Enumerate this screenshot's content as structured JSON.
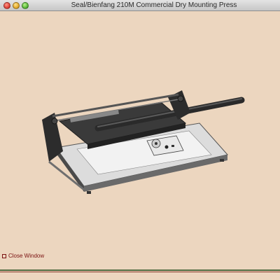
{
  "window": {
    "title": "Seal/Bienfang 210M Commercial Dry Mounting Press"
  },
  "content": {
    "image_alt": "Seal/Bienfang 210M Commercial Dry Mounting Press",
    "close_link_label": "Close Window",
    "close_icon": "close-window-icon"
  },
  "colors": {
    "background": "#ecd6bf",
    "link": "#7a1010",
    "bar_green": "#4f6a3f",
    "bar_red": "#8a3a2a"
  }
}
